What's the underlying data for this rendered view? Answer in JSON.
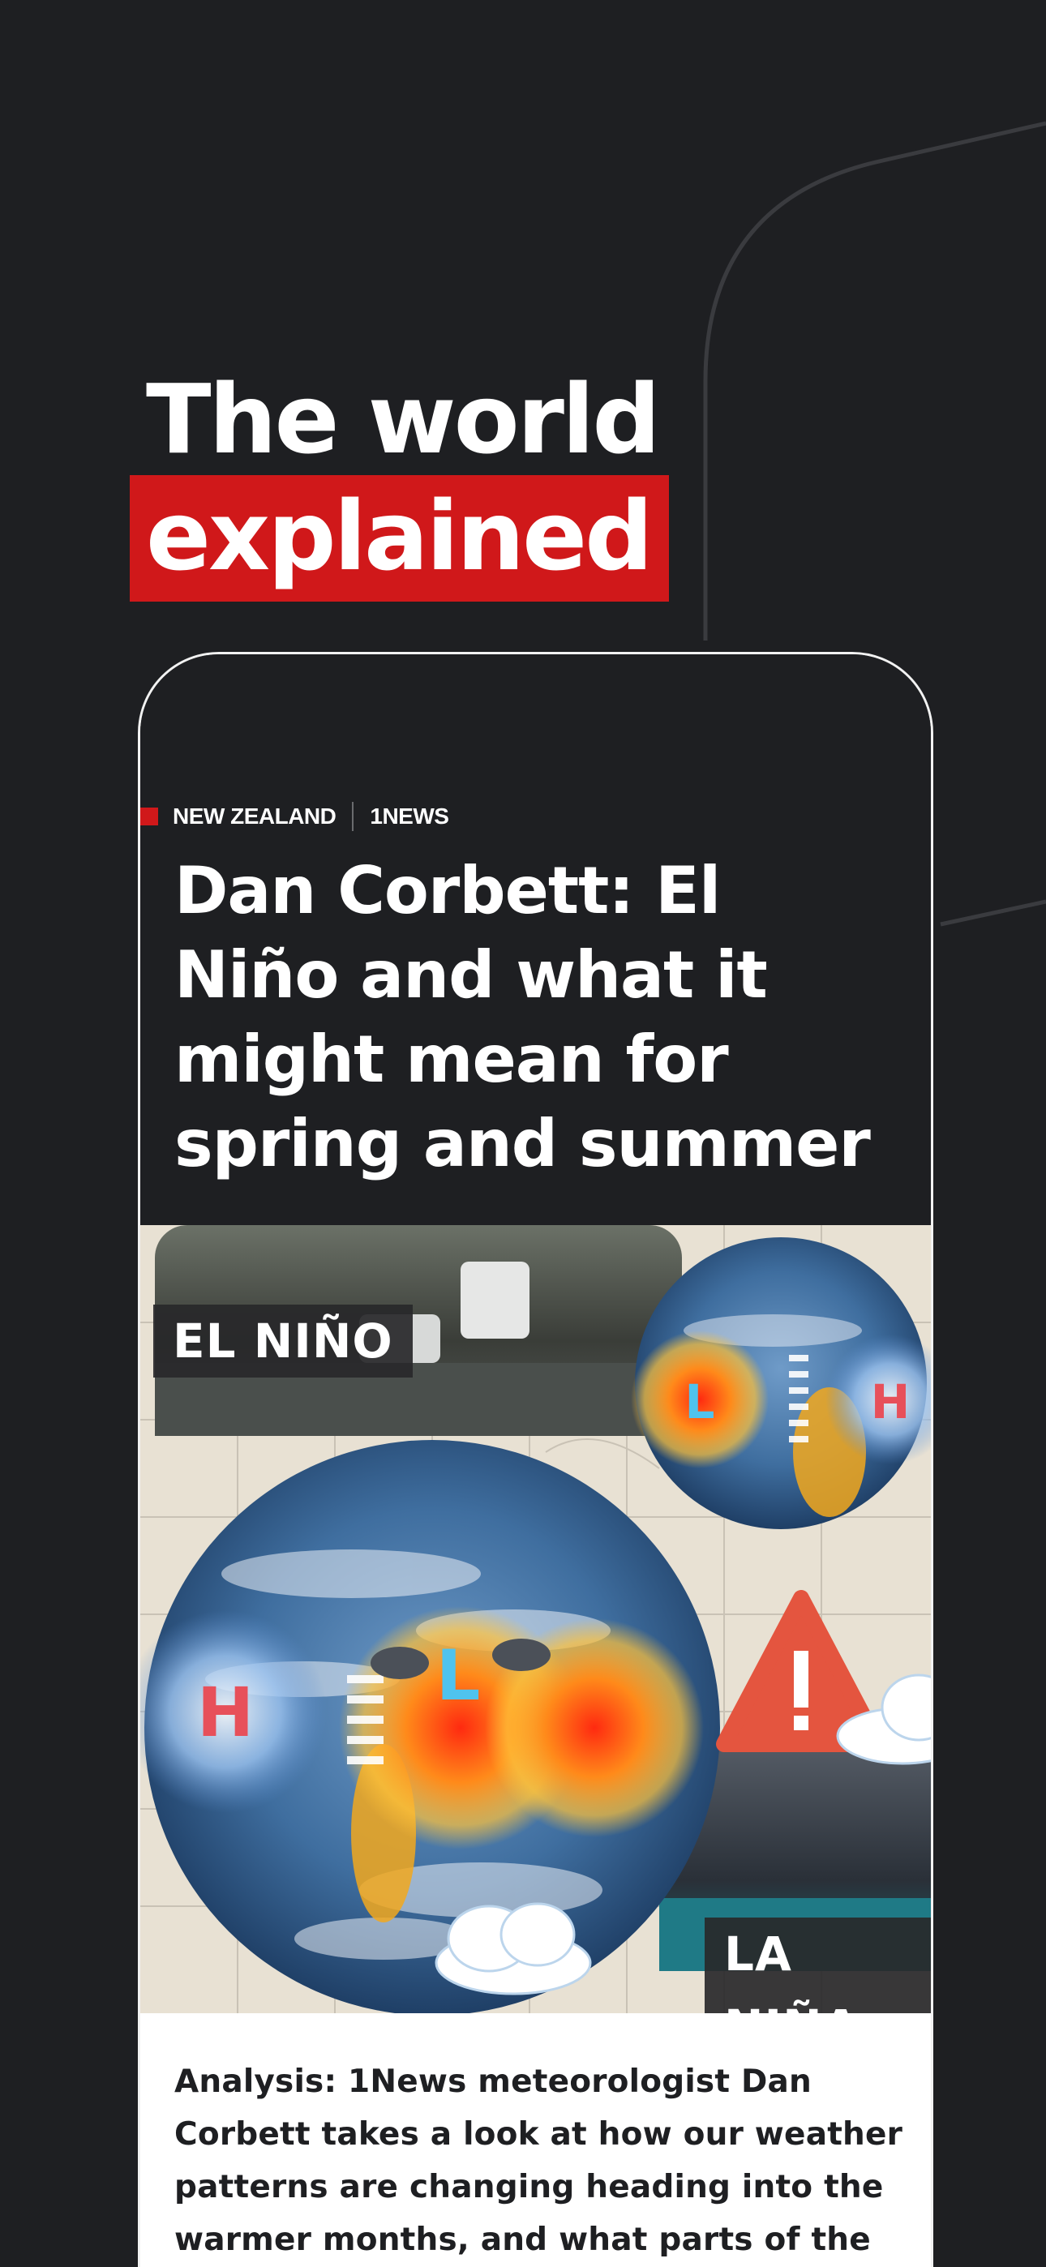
{
  "promo": {
    "headline_line1": "The world",
    "headline_line2": "explained"
  },
  "article": {
    "category": "NEW ZEALAND",
    "source": "1NEWS",
    "title": "Dan Corbett: El Niño and what it might mean for spring and summer",
    "image": {
      "label_left": "EL NIÑO",
      "label_right": "LA NIÑA",
      "high_symbol": "H",
      "low_symbol": "L"
    },
    "summary": "Analysis: 1News meteorologist Dan Corbett takes a look at how our weather patterns are changing heading into the warmer months, and what parts of the country"
  },
  "colors": {
    "background": "#1e1f22",
    "accent_red": "#d0181a",
    "text_light": "#ffffff",
    "text_dark": "#1e1f22"
  }
}
